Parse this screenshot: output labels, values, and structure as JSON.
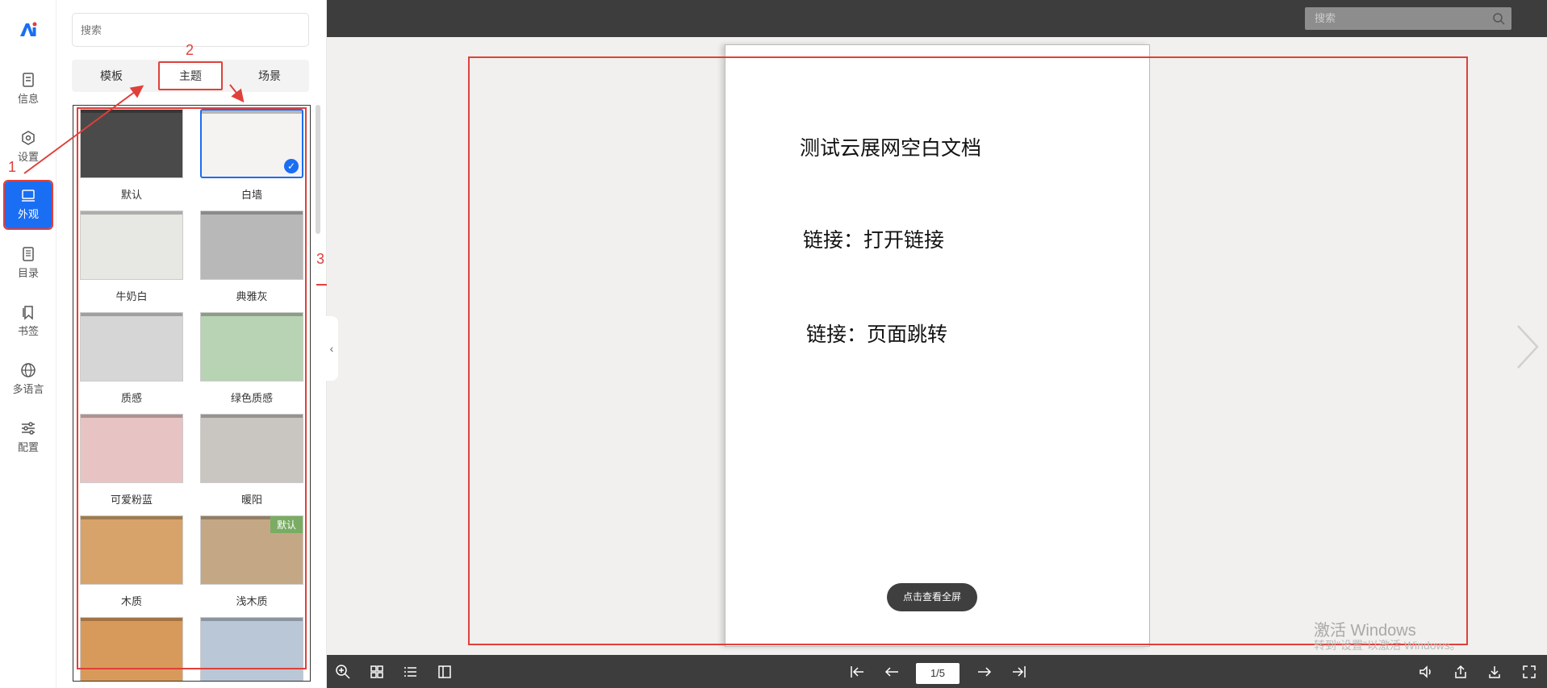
{
  "rail": {
    "items": [
      {
        "label": "信息",
        "icon": "document-icon"
      },
      {
        "label": "设置",
        "icon": "hexagon-gear-icon"
      },
      {
        "label": "外观",
        "icon": "monitor-icon",
        "active": true
      },
      {
        "label": "目录",
        "icon": "list-document-icon"
      },
      {
        "label": "书签",
        "icon": "bookmark-icon"
      },
      {
        "label": "多语言",
        "icon": "globe-icon"
      },
      {
        "label": "配置",
        "icon": "sliders-icon"
      }
    ]
  },
  "panel": {
    "search_placeholder": "搜索",
    "tabs": [
      "模板",
      "主题",
      "场景"
    ],
    "active_tab": "主题",
    "themes": [
      {
        "name": "默认",
        "color": "#4a4a4a"
      },
      {
        "name": "白墙",
        "color": "#f5f2f2",
        "selected": true
      },
      {
        "name": "牛奶白",
        "color": "#e7e8e4"
      },
      {
        "name": "典雅灰",
        "color": "#b8b8b8"
      },
      {
        "name": "质感",
        "color": "#d6d6d6"
      },
      {
        "name": "绿色质感",
        "color": "#b8d3b3"
      },
      {
        "name": "可爱粉蓝",
        "color": "#e8c3c3"
      },
      {
        "name": "暖阳",
        "color": "#c9c5c0"
      },
      {
        "name": "木质",
        "color": "#d7a36a"
      },
      {
        "name": "浅木质",
        "color": "#c4a886",
        "badge": "默认"
      },
      {
        "name": "",
        "color": "#d89a5a"
      },
      {
        "name": "",
        "color": "#b9c7d6"
      }
    ]
  },
  "annotations": {
    "one": "1",
    "two": "2",
    "three": "3"
  },
  "viewer": {
    "search_placeholder": "搜索",
    "page_lines": [
      "测试云展网空白文档",
      "链接：打开链接",
      "链接：页面跳转"
    ],
    "fullscreen_label": "点击查看全屏",
    "page_indicator": "1/5",
    "watermark_line1": "激活 Windows",
    "watermark_line2": "转到\"设置\"以激活 Windows。"
  },
  "colors": {
    "accent": "#1a6ef3",
    "annotation": "#e0403a",
    "toolbar": "#3d3d3d"
  }
}
